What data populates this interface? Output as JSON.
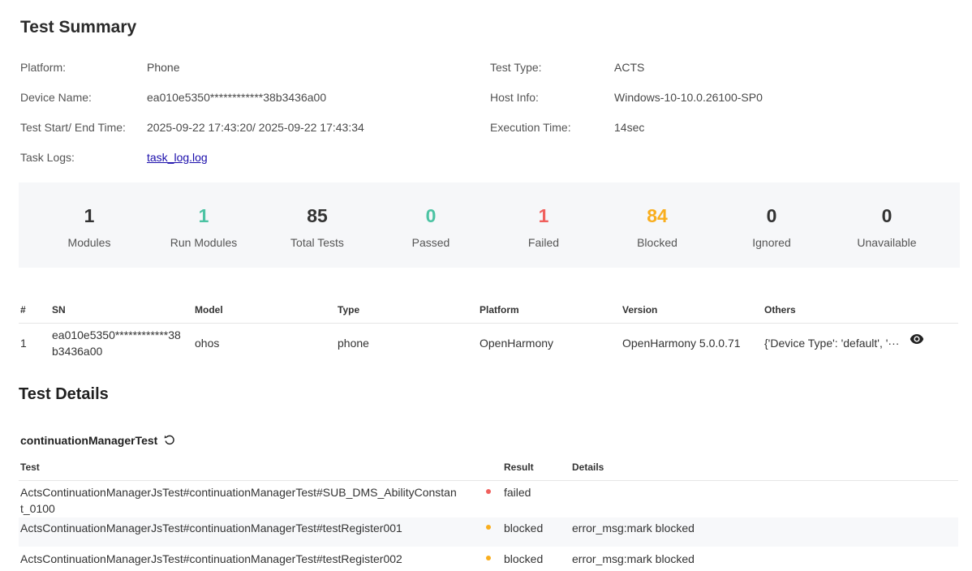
{
  "summary": {
    "title": "Test Summary",
    "platform_label": "Platform:",
    "platform_value": "Phone",
    "device_label": "Device Name:",
    "device_value": "ea010e5350************38b3436a00",
    "time_label": "Test Start/ End Time:",
    "time_value": "2025-09-22 17:43:20/ 2025-09-22 17:43:34",
    "logs_label": "Task Logs:",
    "logs_value": "task_log.log",
    "type_label": "Test Type:",
    "type_value": "ACTS",
    "host_label": "Host Info:",
    "host_value": "Windows-10-10.0.26100-SP0",
    "exec_label": "Execution Time:",
    "exec_value": "14sec"
  },
  "stats": [
    {
      "value": "1",
      "label": "Modules",
      "color": "#333333"
    },
    {
      "value": "1",
      "label": "Run Modules",
      "color": "#4cc3a3"
    },
    {
      "value": "85",
      "label": "Total Tests",
      "color": "#333333"
    },
    {
      "value": "0",
      "label": "Passed",
      "color": "#4cc3a3"
    },
    {
      "value": "1",
      "label": "Failed",
      "color": "#f0605d"
    },
    {
      "value": "84",
      "label": "Blocked",
      "color": "#f9ae1e"
    },
    {
      "value": "0",
      "label": "Ignored",
      "color": "#333333"
    },
    {
      "value": "0",
      "label": "Unavailable",
      "color": "#333333"
    }
  ],
  "devices": {
    "headers": [
      "#",
      "SN",
      "Model",
      "Type",
      "Platform",
      "Version",
      "Others"
    ],
    "rows": [
      {
        "index": "1",
        "sn_line1": "ea010e5350************38",
        "sn_line2": "b3436a00",
        "model": "ohos",
        "type": "phone",
        "platform": "OpenHarmony",
        "version": "OpenHarmony 5.0.0.71",
        "others": "{'Device Type': 'default', '···",
        "others_icon": "eye-icon"
      }
    ]
  },
  "details": {
    "title": "Test Details",
    "module": "continuationManagerTest",
    "module_icon": "refresh-icon",
    "headers": [
      "Test",
      "Result",
      "Details"
    ],
    "rows": [
      {
        "test_line1": "ActsContinuationManagerJsTest#continuationManagerTest#SUB_DMS_AbilityConstan",
        "test_line2": "t_0100",
        "result": "failed",
        "details": "",
        "dot_color": "#f0605d"
      },
      {
        "test_line1": "ActsContinuationManagerJsTest#continuationManagerTest#testRegister001",
        "test_line2": "",
        "result": "blocked",
        "details": "error_msg:mark blocked",
        "dot_color": "#f9ae1e"
      },
      {
        "test_line1": "ActsContinuationManagerJsTest#continuationManagerTest#testRegister002",
        "test_line2": "",
        "result": "blocked",
        "details": "error_msg:mark blocked",
        "dot_color": "#f9ae1e"
      }
    ]
  }
}
